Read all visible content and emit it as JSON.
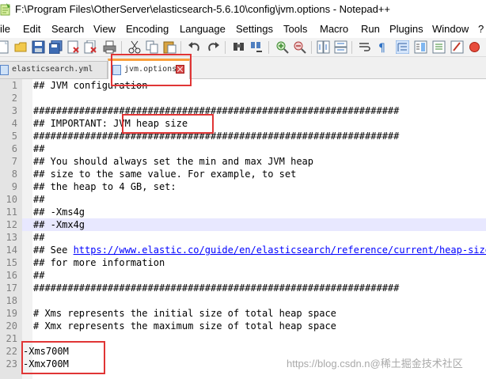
{
  "window": {
    "title": "F:\\Program Files\\OtherServer\\elasticsearch-5.6.10\\config\\jvm.options - Notepad++"
  },
  "menu": [
    "ile",
    "Edit",
    "Search",
    "View",
    "Encoding",
    "Language",
    "Settings",
    "Tools",
    "Macro",
    "Run",
    "Plugins",
    "Window",
    "?"
  ],
  "toolbar": {
    "icons": [
      "new-file-icon",
      "open-file-icon",
      "save-icon",
      "save-all-icon",
      "close-icon",
      "close-all-icon",
      "print-icon",
      "cut-icon",
      "copy-icon",
      "paste-icon",
      "undo-icon",
      "redo-icon",
      "find-icon",
      "replace-icon",
      "zoom-in-icon",
      "zoom-out-icon",
      "sync-vertical-icon",
      "sync-horizontal-icon",
      "word-wrap-icon",
      "show-all-chars-icon",
      "indent-guide-icon",
      "document-map-icon",
      "function-list-icon",
      "folder-as-workspace-icon",
      "monitoring-icon",
      "record-macro-icon"
    ]
  },
  "tabs": [
    {
      "label": "elasticsearch.yml",
      "active": false
    },
    {
      "label": "jvm.options",
      "active": true
    }
  ],
  "editor": {
    "current_line": 12,
    "lines": [
      {
        "n": "1",
        "text": "## JVM configuration"
      },
      {
        "n": "2",
        "text": ""
      },
      {
        "n": "3",
        "text": "################################################################"
      },
      {
        "n": "4",
        "text": "## IMPORTANT: JVM heap size"
      },
      {
        "n": "5",
        "text": "################################################################"
      },
      {
        "n": "6",
        "text": "##"
      },
      {
        "n": "7",
        "text": "## You should always set the min and max JVM heap"
      },
      {
        "n": "8",
        "text": "## size to the same value. For example, to set"
      },
      {
        "n": "9",
        "text": "## the heap to 4 GB, set:"
      },
      {
        "n": "10",
        "text": "##"
      },
      {
        "n": "11",
        "text": "## -Xms4g"
      },
      {
        "n": "12",
        "text": "## -Xmx4g"
      },
      {
        "n": "13",
        "text": "##"
      },
      {
        "n": "14",
        "text_prefix": "## See ",
        "url": "https://www.elastic.co/guide/en/elasticsearch/reference/current/heap-size.html"
      },
      {
        "n": "15",
        "text": "## for more information"
      },
      {
        "n": "16",
        "text": "##"
      },
      {
        "n": "17",
        "text": "################################################################"
      },
      {
        "n": "18",
        "text": ""
      },
      {
        "n": "19",
        "text": "# Xms represents the initial size of total heap space"
      },
      {
        "n": "20",
        "text": "# Xmx represents the maximum size of total heap space"
      },
      {
        "n": "21",
        "text": ""
      },
      {
        "n": "22",
        "text": "-Xms700M"
      },
      {
        "n": "23",
        "text": "-Xmx700M"
      }
    ]
  },
  "watermark": "https://blog.csdn.n@稀土掘金技术社区",
  "colors": {
    "annotation": "#e03535",
    "active_tab_accent": "#fa9f3c",
    "url": "#0000ff",
    "current_line": "#e8e8ff"
  }
}
